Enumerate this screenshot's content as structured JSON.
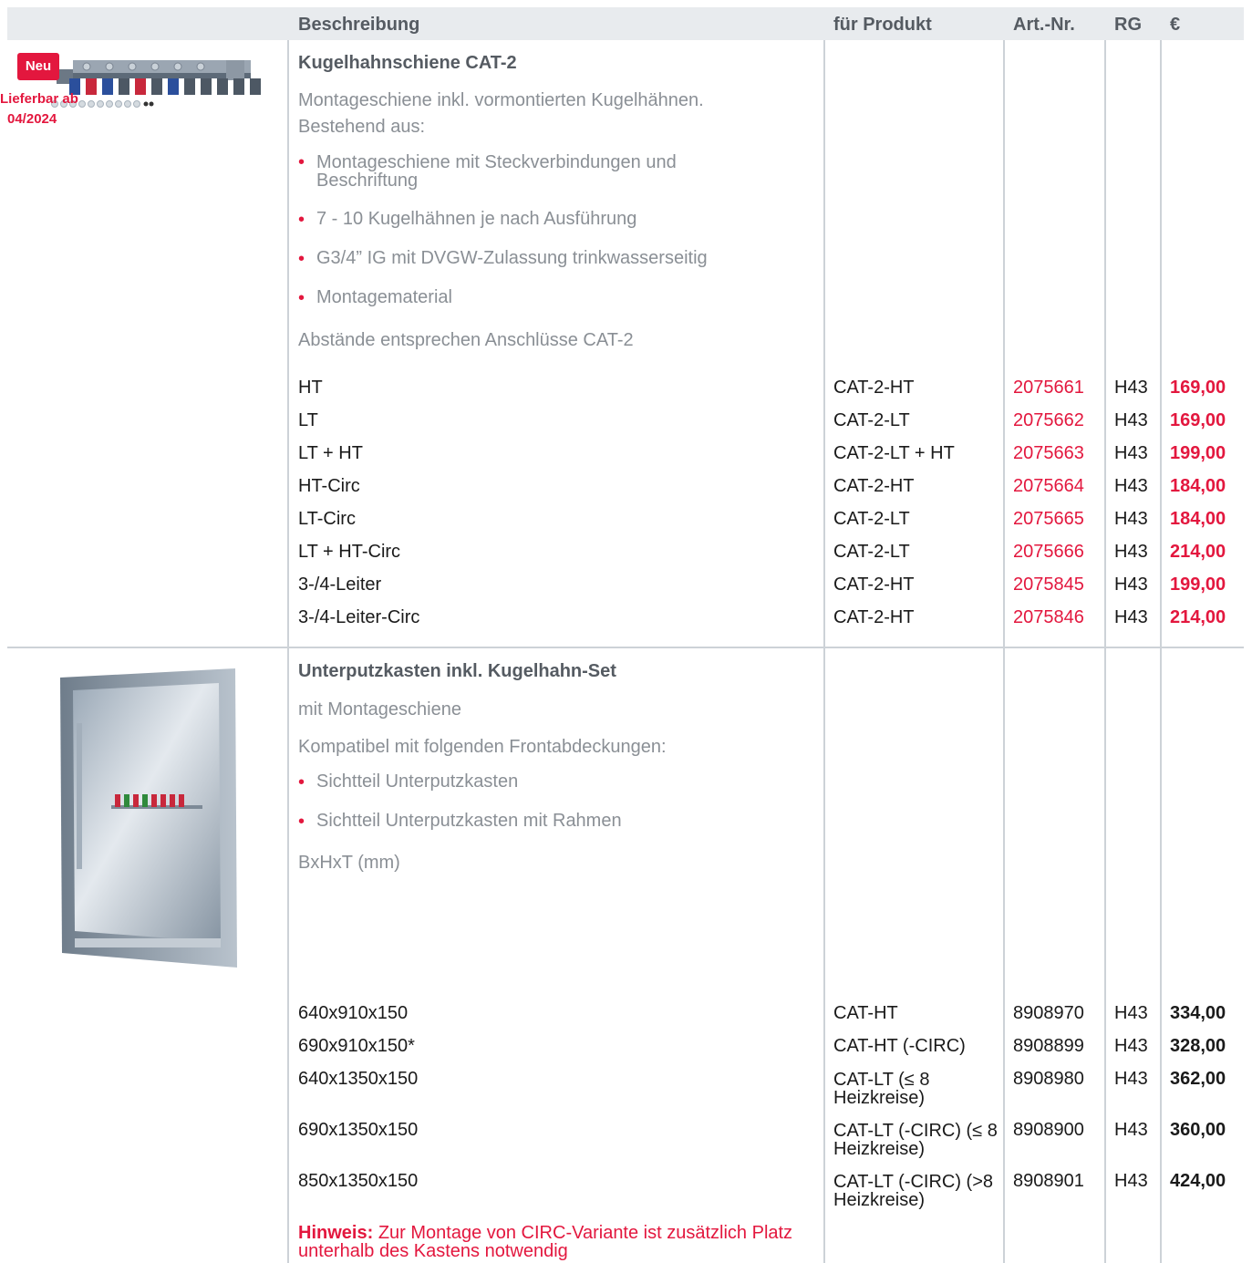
{
  "header": {
    "beschreibung": "Beschreibung",
    "fuer_produkt": "für Produkt",
    "art_nr": "Art.-Nr.",
    "rg": "RG",
    "currency": "€"
  },
  "section1": {
    "badge": "Neu",
    "availability_line1": "Lieferbar ab",
    "availability_line2": "04/2024",
    "title": "Kugelhahnschiene CAT-2",
    "desc1": "Montageschiene inkl. vormontierten Kugelhähnen.",
    "desc2": "Bestehend aus:",
    "bullets": [
      "Montageschiene mit Steckverbindungen und Beschriftung",
      "7 - 10 Kugelhähnen je nach Ausführung",
      "G3/4” IG mit DVGW-Zulassung trinkwasserseitig",
      "Montagematerial"
    ],
    "note": "Abstände entsprechen Anschlüsse CAT-2",
    "rows": [
      {
        "name": "HT",
        "product": "CAT-2-HT",
        "art": "2075661",
        "rg": "H43",
        "price": "169,00"
      },
      {
        "name": "LT",
        "product": "CAT-2-LT",
        "art": "2075662",
        "rg": "H43",
        "price": "169,00"
      },
      {
        "name": "LT + HT",
        "product": "CAT-2-LT + HT",
        "art": "2075663",
        "rg": "H43",
        "price": "199,00"
      },
      {
        "name": "HT-Circ",
        "product": "CAT-2-HT",
        "art": "2075664",
        "rg": "H43",
        "price": "184,00"
      },
      {
        "name": "LT-Circ",
        "product": "CAT-2-LT",
        "art": "2075665",
        "rg": "H43",
        "price": "184,00"
      },
      {
        "name": "LT + HT-Circ",
        "product": "CAT-2-LT",
        "art": "2075666",
        "rg": "H43",
        "price": "214,00"
      },
      {
        "name": "3-/4-Leiter",
        "product": "CAT-2-HT",
        "art": "2075845",
        "rg": "H43",
        "price": "199,00"
      },
      {
        "name": "3-/4-Leiter-Circ",
        "product": "CAT-2-HT",
        "art": "2075846",
        "rg": "H43",
        "price": "214,00"
      }
    ]
  },
  "section2": {
    "title": "Unterputzkasten inkl. Kugelhahn-Set",
    "desc1": "mit Montageschiene",
    "desc2": "Kompatibel mit folgenden Frontabdeckungen:",
    "bullets": [
      "Sichtteil Unterputzkasten",
      "Sichtteil Unterputzkasten mit Rahmen"
    ],
    "dims_label": "BxHxT (mm)",
    "rows": [
      {
        "name": "640x910x150",
        "product": "CAT-HT",
        "art": "8908970",
        "rg": "H43",
        "price": "334,00"
      },
      {
        "name": "690x910x150*",
        "product": "CAT-HT (-CIRC)",
        "art": "8908899",
        "rg": "H43",
        "price": "328,00"
      },
      {
        "name": "640x1350x150",
        "product": "CAT-LT (≤ 8 Heizkreise)",
        "art": "8908980",
        "rg": "H43",
        "price": "362,00"
      },
      {
        "name": "690x1350x150",
        "product": "CAT-LT (-CIRC) (≤ 8 Heizkreise)",
        "art": "8908900",
        "rg": "H43",
        "price": "360,00"
      },
      {
        "name": "850x1350x150",
        "product": "CAT-LT (-CIRC) (>8 Heizkreise)",
        "art": "8908901",
        "rg": "H43",
        "price": "424,00"
      }
    ],
    "hint_label": "Hinweis:",
    "hint_text": "Zur Montage von CIRC-Variante ist zusätzlich Platz unterhalb des Kastens notwendig"
  },
  "colors": {
    "accent_red": "#e3173e",
    "header_bg": "#e8ebee",
    "grid_line": "#cdd2d7"
  }
}
